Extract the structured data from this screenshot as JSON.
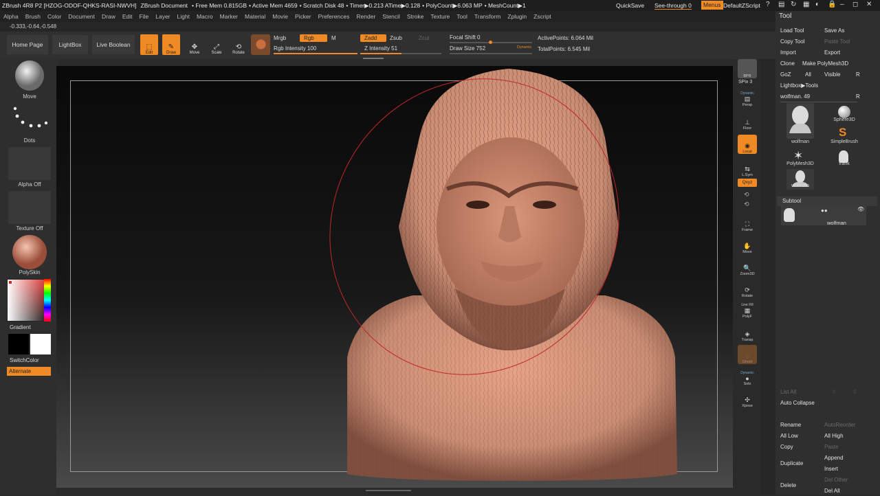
{
  "titlebar": {
    "app": "ZBrush 4R8 P2 [HZOG-ODOF-QHKS-RASI-NWVH]",
    "doc": "ZBrush Document",
    "free_mem": "• Free Mem 0.815GB",
    "active_mem": "• Active Mem 4659",
    "scratch": "• Scratch Disk 48",
    "timer": "• Timer▶0.213 ATime▶0.128",
    "polycount": "• PolyCount▶6.063 MP",
    "meshcount": "• MeshCount▶1",
    "quicksave": "QuickSave",
    "see_through": "See-through  0",
    "menus": "Menus",
    "script": "DefaultZScript"
  },
  "menubar": [
    "Alpha",
    "Brush",
    "Color",
    "Document",
    "Draw",
    "Edit",
    "File",
    "Layer",
    "Light",
    "Macro",
    "Marker",
    "Material",
    "Movie",
    "Picker",
    "Preferences",
    "Render",
    "Stencil",
    "Stroke",
    "Texture",
    "Tool",
    "Transform",
    "Zplugin",
    "Zscript"
  ],
  "coords": "-0.333,-0.64,-0.548",
  "toolbar": {
    "home_page": "Home Page",
    "lightbox": "LightBox",
    "live_boolean": "Live Boolean",
    "edit": "Edit",
    "draw": "Draw",
    "move": "Move",
    "scale": "Scale",
    "rotate": "Rotate",
    "mrgb": "Mrgb",
    "rgb": "Rgb",
    "m": "M",
    "rgb_intensity": "Rgb Intensity 100",
    "zadd": "Zadd",
    "zsub": "Zsub",
    "zcut": "Zcut",
    "z_intensity": "Z Intensity 51",
    "focal_shift": "Focal Shift 0",
    "draw_size": "Draw Size 752",
    "dynamic": "Dynamic",
    "active_points": "ActivePoints: 6.064 Mil",
    "total_points": "TotalPoints: 6.545 Mil",
    "rgb_intensity_value": 1.0,
    "z_intensity_value": 0.51
  },
  "leftshelf": {
    "brush": "Move",
    "stroke": "Dots",
    "alpha": "Alpha Off",
    "texture": "Texture Off",
    "material": "PolySkin",
    "gradient": "Gradient",
    "switchcolor": "SwitchColor",
    "alternate": "Alternate"
  },
  "rightshelf": [
    "BPR",
    "SPix 3",
    "Dynamic",
    "Persp",
    "Floor",
    "Local",
    "L.Sym",
    "Qxyz",
    "Frame",
    "Move",
    "Zoom3D",
    "Rotate",
    "Line Fill",
    "PolyF",
    "Transp",
    "Ghost",
    "Dynamic",
    "Solo",
    "Xpose"
  ],
  "tray": {
    "title": "Tool",
    "load_tool": "Load Tool",
    "save_as": "Save As",
    "copy_tool": "Copy Tool",
    "paste_tool": "Paste Tool",
    "import": "Import",
    "export": "Export",
    "clone": "Clone",
    "make_polymesh": "Make PolyMesh3D",
    "goz": "GoZ",
    "all": "All",
    "visible": "Visible",
    "r": "R",
    "lightbox_tools": "Lightbox▶Tools",
    "current_tool": "wolfman. 49",
    "tools": [
      "wolfman",
      "Sphere3D",
      "SimpleBrush",
      "PolyMesh3D",
      "frank",
      "wolfman"
    ],
    "subtool_header": "Subtool",
    "subtool_item": "wolfman",
    "list_all": "List All",
    "auto_collapse": "Auto Collapse",
    "rename": "Rename",
    "auto_reorder": "AutoReorder",
    "all_low": "All Low",
    "all_high": "All High",
    "copy": "Copy",
    "paste": "Paste",
    "append": "Append",
    "duplicate": "Duplicate",
    "insert": "Insert",
    "delete": "Delete",
    "del_other": "Del Other",
    "del_all": "Del All"
  }
}
